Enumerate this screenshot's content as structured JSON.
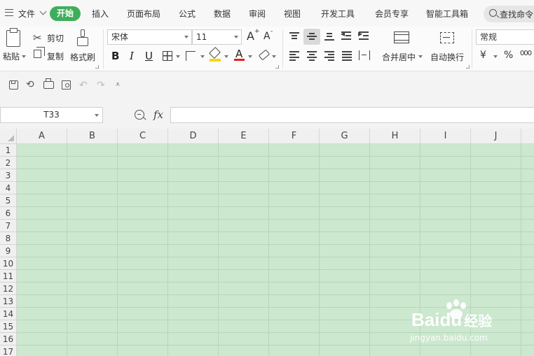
{
  "menu": {
    "file": "文件",
    "active_tab": "开始",
    "tabs": [
      "插入",
      "页面布局",
      "公式",
      "数据",
      "审阅",
      "视图",
      "开发工具",
      "会员专享",
      "智能工具箱"
    ],
    "search_placeholder": "查找命令"
  },
  "ribbon": {
    "paste": "粘贴",
    "cut": "剪切",
    "copy": "复制",
    "format_painter": "格式刷",
    "font_name": "宋体",
    "font_size": "11",
    "grow_font": "A",
    "shrink_font": "A",
    "bold": "B",
    "italic": "I",
    "underline": "U",
    "font_color_glyph": "A",
    "merge_center": "合并居中",
    "wrap_text": "自动换行",
    "number_format": "常规",
    "currency": "¥",
    "percent": "%",
    "thousands": "000"
  },
  "formula_bar": {
    "name_box": "T33",
    "fx": "fx",
    "formula": ""
  },
  "grid": {
    "columns": [
      "A",
      "B",
      "C",
      "D",
      "E",
      "F",
      "G",
      "H",
      "I",
      "J"
    ],
    "rows": [
      "1",
      "2",
      "3",
      "4",
      "5",
      "6",
      "7",
      "8",
      "9",
      "10",
      "11",
      "12",
      "13",
      "14",
      "15",
      "16",
      "17"
    ],
    "fill_color": "#cce8cf"
  },
  "colors": {
    "accent": "#3fae5a",
    "font_color_bar": "#e02020",
    "highlight_bar": "#f5d800"
  },
  "watermark": {
    "brand": "Bai",
    "brand2": "du",
    "brand_cn": "经验",
    "url": "jingyan.baidu.com"
  }
}
